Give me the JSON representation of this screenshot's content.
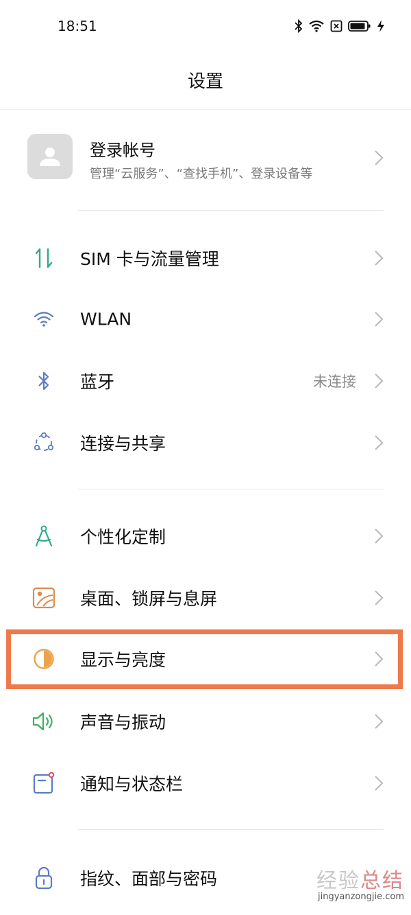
{
  "status_bar": {
    "time": "18:51"
  },
  "header": {
    "title": "设置"
  },
  "account": {
    "title": "登录帐号",
    "subtitle": "管理“云服务”、“查找手机”、登录设备等"
  },
  "items": [
    {
      "label": "SIM 卡与流量管理",
      "icon": "sim-data-icon",
      "value": ""
    },
    {
      "label": "WLAN",
      "icon": "wifi-icon",
      "value": ""
    },
    {
      "label": "蓝牙",
      "icon": "bluetooth-icon",
      "value": "未连接"
    },
    {
      "label": "连接与共享",
      "icon": "share-connection-icon",
      "value": ""
    },
    {
      "label": "个性化定制",
      "icon": "compass-icon",
      "value": ""
    },
    {
      "label": "桌面、锁屏与息屏",
      "icon": "wallpaper-icon",
      "value": ""
    },
    {
      "label": "显示与亮度",
      "icon": "brightness-icon",
      "value": ""
    },
    {
      "label": "声音与振动",
      "icon": "speaker-icon",
      "value": ""
    },
    {
      "label": "通知与状态栏",
      "icon": "notification-icon",
      "value": ""
    },
    {
      "label": "指纹、面部与密码",
      "icon": "lock-icon",
      "value": ""
    }
  ],
  "highlight_color": "#ee7a4a",
  "watermark": {
    "main_a": "经验",
    "main_b": "总结",
    "sub": "jingyanzongjie.com"
  }
}
